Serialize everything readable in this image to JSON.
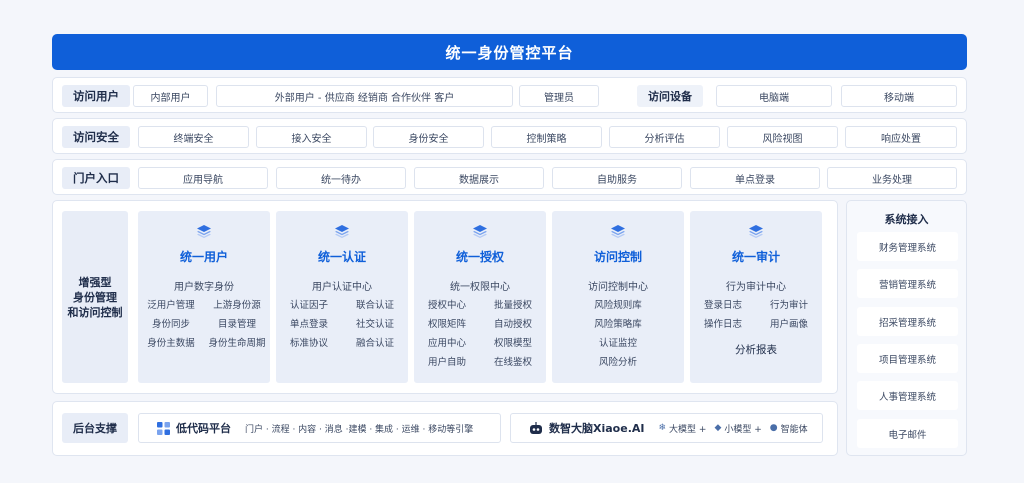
{
  "title": "统一身份管控平台",
  "access_users": {
    "label": "访问用户",
    "items": [
      "内部用户",
      "外部用户 - 供应商 经销商 合作伙伴 客户",
      "管理员"
    ],
    "device_label": "访问设备",
    "devices": [
      "电脑端",
      "移动端"
    ]
  },
  "access_security": {
    "label": "访问安全",
    "items": [
      "终端安全",
      "接入安全",
      "身份安全",
      "控制策略",
      "分析评估",
      "风险视图",
      "响应处置"
    ]
  },
  "portal": {
    "label": "门户入口",
    "items": [
      "应用导航",
      "统一待办",
      "数据展示",
      "自助服务",
      "单点登录",
      "业务处理"
    ]
  },
  "core": {
    "label_lines": [
      "增强型",
      "身份管理",
      "和访问控制"
    ],
    "columns": [
      {
        "icon": "layers-icon",
        "title": "统一用户",
        "subtitle": "用户数字身份",
        "items": [
          "泛用户管理",
          "上游身份源",
          "身份同步",
          "目录管理",
          "身份主数据",
          "身份生命周期"
        ]
      },
      {
        "icon": "layers-icon",
        "title": "统一认证",
        "subtitle": "用户认证中心",
        "items": [
          "认证因子",
          "联合认证",
          "单点登录",
          "社交认证",
          "标准协议",
          "融合认证"
        ]
      },
      {
        "icon": "layers-icon",
        "title": "统一授权",
        "subtitle": "统一权限中心",
        "items": [
          "授权中心",
          "批量授权",
          "权限矩阵",
          "自动授权",
          "应用中心",
          "权限模型",
          "用户自助",
          "在线鉴权"
        ]
      },
      {
        "icon": "layers-icon",
        "title": "访问控制",
        "subtitle": "访问控制中心",
        "items": [
          "风险规则库",
          "风险策略库",
          "认证监控",
          "风险分析"
        ]
      },
      {
        "icon": "layers-icon",
        "title": "统一审计",
        "subtitle": "行为审计中心",
        "items": [
          "登录日志",
          "行为审计",
          "操作日志",
          "用户画像"
        ],
        "extra": "分析报表"
      }
    ]
  },
  "systems": {
    "title": "系统接入",
    "items": [
      "财务管理系统",
      "营销管理系统",
      "招采管理系统",
      "项目管理系统",
      "人事管理系统",
      "电子邮件"
    ]
  },
  "backend": {
    "label": "后台支撑",
    "lowcode": {
      "icon": "lowcode-icon",
      "name": "低代码平台",
      "desc": "门户 · 流程 · 内容 · 消息 ·建模 · 集成 · 运维 · 移动等引擎"
    },
    "ai": {
      "icon": "robot-icon",
      "name": "数智大脑Xiaoe.AI",
      "chips": [
        {
          "icon": "snowflake-icon",
          "text": "大模型 +"
        },
        {
          "icon": "cube-icon",
          "text": "小模型 +"
        },
        {
          "icon": "agent-icon",
          "text": "智能体"
        }
      ]
    }
  },
  "colors": {
    "accent": "#0f5fd9",
    "panel": "#e9eef8",
    "background": "#f4f6fb"
  }
}
